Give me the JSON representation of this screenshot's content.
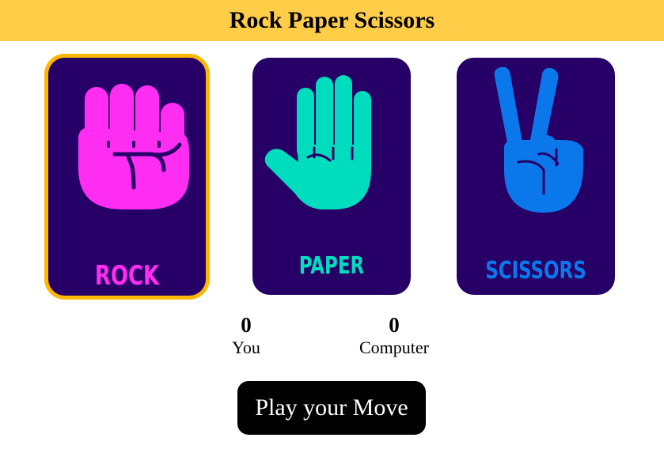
{
  "header": {
    "title": "Rock Paper Scissors"
  },
  "cards": {
    "rock": {
      "label": "ROCK",
      "selected": true,
      "icon": "fist-icon",
      "color": "#ff2cf2"
    },
    "paper": {
      "label": "PAPER",
      "selected": false,
      "icon": "open-hand-icon",
      "color": "#00dcbe"
    },
    "scissors": {
      "label": "SCISSORS",
      "selected": false,
      "icon": "victory-hand-icon",
      "color": "#0a78ea"
    }
  },
  "card_background": "#270067",
  "selection_color": "#ffb800",
  "scores": {
    "you": {
      "value": "0",
      "label": "You"
    },
    "computer": {
      "value": "0",
      "label": "Computer"
    }
  },
  "play_button": {
    "label": "Play your Move"
  },
  "accent": "#ffcd47"
}
